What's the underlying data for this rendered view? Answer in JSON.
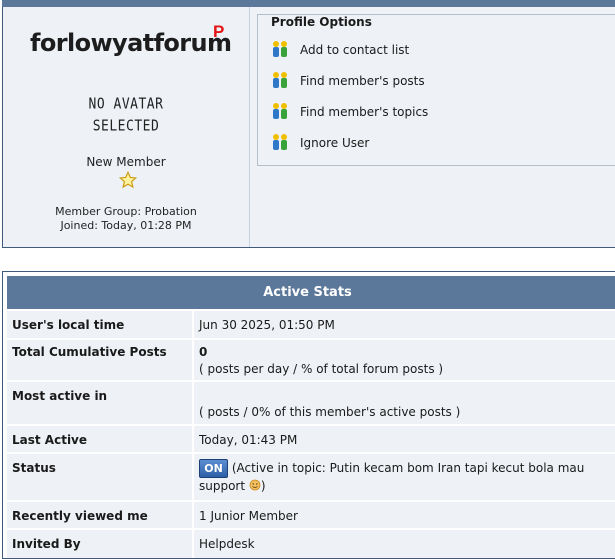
{
  "profile": {
    "logo_text": "forlowyatforum",
    "logo_badge": "P",
    "no_avatar_line1": "NO AVATAR",
    "no_avatar_line2": "SELECTED",
    "member_title": "New Member",
    "member_group": "Member Group: Probation",
    "joined": "Joined: Today, 01:28 PM"
  },
  "options": {
    "legend": "Profile Options",
    "items": [
      {
        "label": "Add to contact list",
        "icon": "members-icon"
      },
      {
        "label": "Find member's posts",
        "icon": "members-icon"
      },
      {
        "label": "Find member's topics",
        "icon": "members-icon"
      },
      {
        "label": "Ignore User",
        "icon": "members-icon"
      }
    ]
  },
  "stats": {
    "title": "Active Stats",
    "local_time": {
      "label": "User's local time",
      "value": "Jun 30 2025, 01:50 PM"
    },
    "total_posts": {
      "label": "Total Cumulative Posts",
      "value": "0",
      "sub": "( posts per day / % of total forum posts )"
    },
    "most_active": {
      "label": "Most active in",
      "value": "",
      "sub": "( posts / 0% of this member's active posts )"
    },
    "last_active": {
      "label": "Last Active",
      "value": "Today, 01:43 PM"
    },
    "status": {
      "label": "Status",
      "badge": "ON",
      "text": "(Active in topic: Putin kecam bom Iran tapi kecut bola mau support",
      "closing": ")"
    },
    "recently_viewed": {
      "label": "Recently viewed me",
      "value": "1 Junior Member"
    },
    "invited_by": {
      "label": "Invited By",
      "value": "Helpdesk"
    }
  },
  "colors": {
    "header_bg": "#5b7799",
    "panel_bg": "#eef2f7",
    "on_badge": "#2d5fa8",
    "logo_badge": "#e31414"
  }
}
